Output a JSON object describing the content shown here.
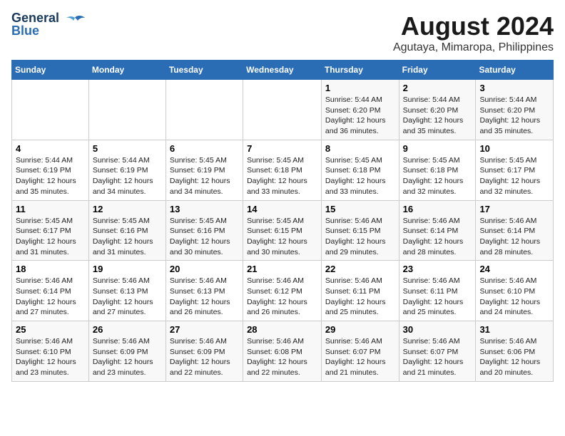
{
  "header": {
    "logo_line1": "General",
    "logo_line2": "Blue",
    "main_title": "August 2024",
    "subtitle": "Agutaya, Mimaropa, Philippines"
  },
  "calendar": {
    "days_of_week": [
      "Sunday",
      "Monday",
      "Tuesday",
      "Wednesday",
      "Thursday",
      "Friday",
      "Saturday"
    ],
    "weeks": [
      [
        {
          "day": "",
          "info": ""
        },
        {
          "day": "",
          "info": ""
        },
        {
          "day": "",
          "info": ""
        },
        {
          "day": "",
          "info": ""
        },
        {
          "day": "1",
          "info": "Sunrise: 5:44 AM\nSunset: 6:20 PM\nDaylight: 12 hours\nand 36 minutes."
        },
        {
          "day": "2",
          "info": "Sunrise: 5:44 AM\nSunset: 6:20 PM\nDaylight: 12 hours\nand 35 minutes."
        },
        {
          "day": "3",
          "info": "Sunrise: 5:44 AM\nSunset: 6:20 PM\nDaylight: 12 hours\nand 35 minutes."
        }
      ],
      [
        {
          "day": "4",
          "info": "Sunrise: 5:44 AM\nSunset: 6:19 PM\nDaylight: 12 hours\nand 35 minutes."
        },
        {
          "day": "5",
          "info": "Sunrise: 5:44 AM\nSunset: 6:19 PM\nDaylight: 12 hours\nand 34 minutes."
        },
        {
          "day": "6",
          "info": "Sunrise: 5:45 AM\nSunset: 6:19 PM\nDaylight: 12 hours\nand 34 minutes."
        },
        {
          "day": "7",
          "info": "Sunrise: 5:45 AM\nSunset: 6:18 PM\nDaylight: 12 hours\nand 33 minutes."
        },
        {
          "day": "8",
          "info": "Sunrise: 5:45 AM\nSunset: 6:18 PM\nDaylight: 12 hours\nand 33 minutes."
        },
        {
          "day": "9",
          "info": "Sunrise: 5:45 AM\nSunset: 6:18 PM\nDaylight: 12 hours\nand 32 minutes."
        },
        {
          "day": "10",
          "info": "Sunrise: 5:45 AM\nSunset: 6:17 PM\nDaylight: 12 hours\nand 32 minutes."
        }
      ],
      [
        {
          "day": "11",
          "info": "Sunrise: 5:45 AM\nSunset: 6:17 PM\nDaylight: 12 hours\nand 31 minutes."
        },
        {
          "day": "12",
          "info": "Sunrise: 5:45 AM\nSunset: 6:16 PM\nDaylight: 12 hours\nand 31 minutes."
        },
        {
          "day": "13",
          "info": "Sunrise: 5:45 AM\nSunset: 6:16 PM\nDaylight: 12 hours\nand 30 minutes."
        },
        {
          "day": "14",
          "info": "Sunrise: 5:45 AM\nSunset: 6:15 PM\nDaylight: 12 hours\nand 30 minutes."
        },
        {
          "day": "15",
          "info": "Sunrise: 5:46 AM\nSunset: 6:15 PM\nDaylight: 12 hours\nand 29 minutes."
        },
        {
          "day": "16",
          "info": "Sunrise: 5:46 AM\nSunset: 6:14 PM\nDaylight: 12 hours\nand 28 minutes."
        },
        {
          "day": "17",
          "info": "Sunrise: 5:46 AM\nSunset: 6:14 PM\nDaylight: 12 hours\nand 28 minutes."
        }
      ],
      [
        {
          "day": "18",
          "info": "Sunrise: 5:46 AM\nSunset: 6:14 PM\nDaylight: 12 hours\nand 27 minutes."
        },
        {
          "day": "19",
          "info": "Sunrise: 5:46 AM\nSunset: 6:13 PM\nDaylight: 12 hours\nand 27 minutes."
        },
        {
          "day": "20",
          "info": "Sunrise: 5:46 AM\nSunset: 6:13 PM\nDaylight: 12 hours\nand 26 minutes."
        },
        {
          "day": "21",
          "info": "Sunrise: 5:46 AM\nSunset: 6:12 PM\nDaylight: 12 hours\nand 26 minutes."
        },
        {
          "day": "22",
          "info": "Sunrise: 5:46 AM\nSunset: 6:11 PM\nDaylight: 12 hours\nand 25 minutes."
        },
        {
          "day": "23",
          "info": "Sunrise: 5:46 AM\nSunset: 6:11 PM\nDaylight: 12 hours\nand 25 minutes."
        },
        {
          "day": "24",
          "info": "Sunrise: 5:46 AM\nSunset: 6:10 PM\nDaylight: 12 hours\nand 24 minutes."
        }
      ],
      [
        {
          "day": "25",
          "info": "Sunrise: 5:46 AM\nSunset: 6:10 PM\nDaylight: 12 hours\nand 23 minutes."
        },
        {
          "day": "26",
          "info": "Sunrise: 5:46 AM\nSunset: 6:09 PM\nDaylight: 12 hours\nand 23 minutes."
        },
        {
          "day": "27",
          "info": "Sunrise: 5:46 AM\nSunset: 6:09 PM\nDaylight: 12 hours\nand 22 minutes."
        },
        {
          "day": "28",
          "info": "Sunrise: 5:46 AM\nSunset: 6:08 PM\nDaylight: 12 hours\nand 22 minutes."
        },
        {
          "day": "29",
          "info": "Sunrise: 5:46 AM\nSunset: 6:07 PM\nDaylight: 12 hours\nand 21 minutes."
        },
        {
          "day": "30",
          "info": "Sunrise: 5:46 AM\nSunset: 6:07 PM\nDaylight: 12 hours\nand 21 minutes."
        },
        {
          "day": "31",
          "info": "Sunrise: 5:46 AM\nSunset: 6:06 PM\nDaylight: 12 hours\nand 20 minutes."
        }
      ]
    ]
  }
}
